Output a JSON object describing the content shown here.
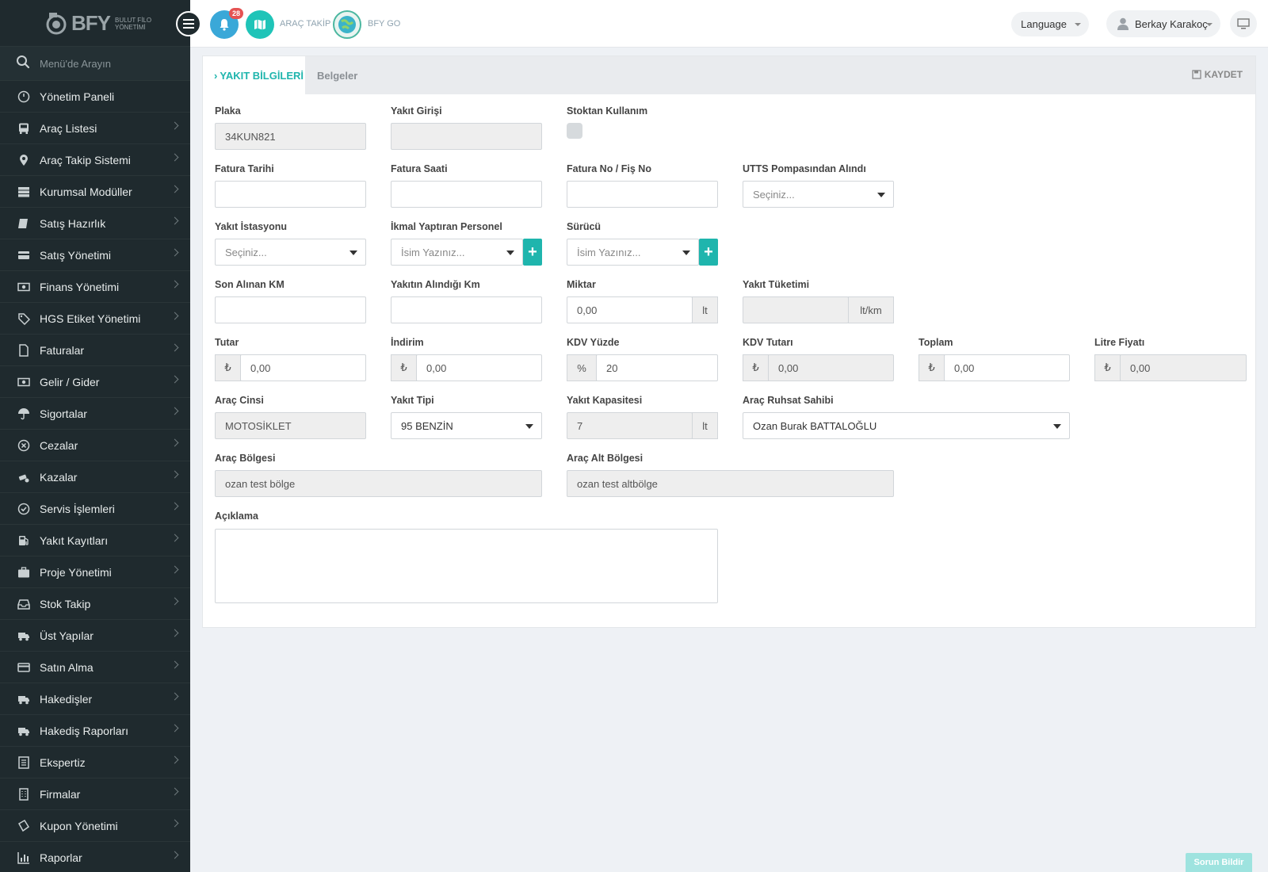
{
  "brand": {
    "name": "BFY",
    "sub_line1": "BULUT FİLO",
    "sub_line2": "YÖNETİMİ"
  },
  "sidebar": {
    "search_placeholder": "Menü'de Arayın",
    "items": [
      {
        "label": "Yönetim Paneli",
        "icon": "dashboard-icon",
        "chevron": false
      },
      {
        "label": "Araç Listesi",
        "icon": "bus-icon",
        "chevron": true
      },
      {
        "label": "Araç Takip Sistemi",
        "icon": "map-pin-icon",
        "chevron": true
      },
      {
        "label": "Kurumsal Modüller",
        "icon": "server-icon",
        "chevron": true
      },
      {
        "label": "Satış Hazırlık",
        "icon": "book-icon",
        "chevron": true
      },
      {
        "label": "Satış Yönetimi",
        "icon": "card-icon",
        "chevron": true
      },
      {
        "label": "Finans Yönetimi",
        "icon": "money-icon",
        "chevron": true
      },
      {
        "label": "HGS Etiket Yönetimi",
        "icon": "tag-icon",
        "chevron": true
      },
      {
        "label": "Faturalar",
        "icon": "file-icon",
        "chevron": true
      },
      {
        "label": "Gelir / Gider",
        "icon": "cash-icon",
        "chevron": true
      },
      {
        "label": "Sigortalar",
        "icon": "umbrella-icon",
        "chevron": true
      },
      {
        "label": "Cezalar",
        "icon": "x-circle-icon",
        "chevron": true
      },
      {
        "label": "Kazalar",
        "icon": "crash-icon",
        "chevron": true
      },
      {
        "label": "Servis İşlemleri",
        "icon": "check-circle-icon",
        "chevron": true
      },
      {
        "label": "Yakıt Kayıtları",
        "icon": "fuel-icon",
        "chevron": true
      },
      {
        "label": "Proje Yönetimi",
        "icon": "briefcase-icon",
        "chevron": true
      },
      {
        "label": "Stok Takip",
        "icon": "box-icon",
        "chevron": true
      },
      {
        "label": "Üst Yapılar",
        "icon": "truck-icon",
        "chevron": true
      },
      {
        "label": "Satın Alma",
        "icon": "credit-card-icon",
        "chevron": true
      },
      {
        "label": "Hakedişler",
        "icon": "truck-icon",
        "chevron": true
      },
      {
        "label": "Hakediş Raporları",
        "icon": "truck-icon",
        "chevron": true
      },
      {
        "label": "Ekspertiz",
        "icon": "list-icon",
        "chevron": true
      },
      {
        "label": "Firmalar",
        "icon": "building-icon",
        "chevron": true
      },
      {
        "label": "Kupon Yönetimi",
        "icon": "ticket-icon",
        "chevron": true
      },
      {
        "label": "Raporlar",
        "icon": "bar-chart-icon",
        "chevron": true
      }
    ]
  },
  "topbar": {
    "notification_count": "28",
    "arac_takip": "ARAÇ TAKİP",
    "bfy_go": "BFY GO",
    "language": "Language",
    "user_name": "Berkay Karakoç"
  },
  "tabs": {
    "active": "YAKIT BİLGİLERİ",
    "inactive": "Belgeler",
    "save": "KAYDET"
  },
  "form": {
    "plaka": {
      "label": "Plaka",
      "value": "34KUN821"
    },
    "yakit_girisi": {
      "label": "Yakıt Girişi",
      "value": ""
    },
    "stoktan": {
      "label": "Stoktan Kullanım"
    },
    "fatura_tarihi": {
      "label": "Fatura Tarihi",
      "value": ""
    },
    "fatura_saati": {
      "label": "Fatura Saati",
      "value": ""
    },
    "fatura_no": {
      "label": "Fatura No / Fiş No",
      "value": ""
    },
    "utts": {
      "label": "UTTS Pompasından Alındı",
      "placeholder": "Seçiniz..."
    },
    "istasyon": {
      "label": "Yakıt İstasyonu",
      "placeholder": "Seçiniz..."
    },
    "ikmal": {
      "label": "İkmal Yaptıran Personel",
      "placeholder": "İsim Yazınız..."
    },
    "surucu": {
      "label": "Sürücü",
      "placeholder": "İsim Yazınız..."
    },
    "son_km": {
      "label": "Son Alınan KM",
      "value": ""
    },
    "alindigi_km": {
      "label": "Yakıtın Alındığı Km",
      "value": ""
    },
    "miktar": {
      "label": "Miktar",
      "value": "0,00",
      "unit": "lt"
    },
    "tuketim": {
      "label": "Yakıt Tüketimi",
      "value": "",
      "unit": "lt/km"
    },
    "tutar": {
      "label": "Tutar",
      "value": "0,00",
      "prefix": "₺"
    },
    "indirim": {
      "label": "İndirim",
      "value": "0,00",
      "prefix": "₺"
    },
    "kdv_yuzde": {
      "label": "KDV Yüzde",
      "value": "20",
      "prefix": "%"
    },
    "kdv_tutari": {
      "label": "KDV Tutarı",
      "value": "0,00",
      "prefix": "₺"
    },
    "toplam": {
      "label": "Toplam",
      "value": "0,00",
      "prefix": "₺"
    },
    "litre_fiyati": {
      "label": "Litre Fiyatı",
      "value": "0,00",
      "prefix": "₺"
    },
    "arac_cinsi": {
      "label": "Araç Cinsi",
      "value": "MOTOSİKLET"
    },
    "yakit_tipi": {
      "label": "Yakıt Tipi",
      "value": "95 BENZİN"
    },
    "kapasite": {
      "label": "Yakıt Kapasitesi",
      "value": "7",
      "unit": "lt"
    },
    "ruhsat": {
      "label": "Araç Ruhsat Sahibi",
      "value": "Ozan Burak BATTALOĞLU"
    },
    "bolge": {
      "label": "Araç Bölgesi",
      "value": "ozan test bölge"
    },
    "alt_bolge": {
      "label": "Araç Alt Bölgesi",
      "value": "ozan test altbölge"
    },
    "aciklama": {
      "label": "Açıklama",
      "value": ""
    }
  },
  "report_button": "Sorun Bildir",
  "colors": {
    "accent": "#1fb5ad",
    "sidebar": "#1f2a2e",
    "badge": "#e55353"
  }
}
